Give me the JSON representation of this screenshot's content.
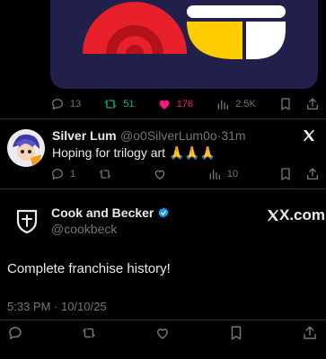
{
  "post1": {
    "replies": "13",
    "reposts": "51",
    "likes": "176",
    "views": "2.5K",
    "colors": {
      "repost_active": "#00ba7c",
      "like_active": "#f91880"
    }
  },
  "reply": {
    "name": "Silver Lum",
    "handle": "@o0SilverLum0o",
    "separator": "·",
    "time": "31m",
    "text": "Hoping for trilogy art 🙏🙏🙏",
    "replies": "1",
    "views": "10"
  },
  "quoted": {
    "name": "Cook and Becker",
    "handle": "@cookbeck",
    "brand": "X.com",
    "text": "Complete franchise history!",
    "timestamp": "5:33 PM · 10/10/25",
    "verified_color": "#1d9bf0"
  }
}
